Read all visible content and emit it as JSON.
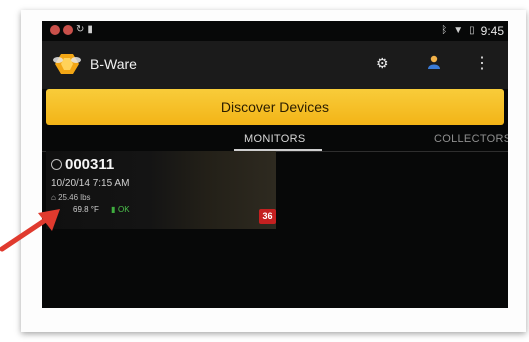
{
  "statusbar": {
    "time": "9:45"
  },
  "appbar": {
    "title": "B-Ware",
    "icons": [
      "gear-icon",
      "user-icon",
      "overflow-menu-icon"
    ]
  },
  "discover_button": {
    "label": "Discover Devices"
  },
  "tabs": [
    {
      "label": "MONITORS",
      "selected": true
    },
    {
      "label": "COLLECTORS",
      "selected": false
    }
  ],
  "monitor_card": {
    "id": "000311",
    "date": "10/20/14 7:15 AM",
    "weight": "25.46 lbs",
    "temperature": "69.8 °F",
    "status": "OK",
    "badge": "36"
  },
  "colors": {
    "accent_yellow": "#f5bd22",
    "badge_red": "#c42020",
    "ok_green": "#4cc24c",
    "annotation_arrow": "#e03a2e"
  }
}
